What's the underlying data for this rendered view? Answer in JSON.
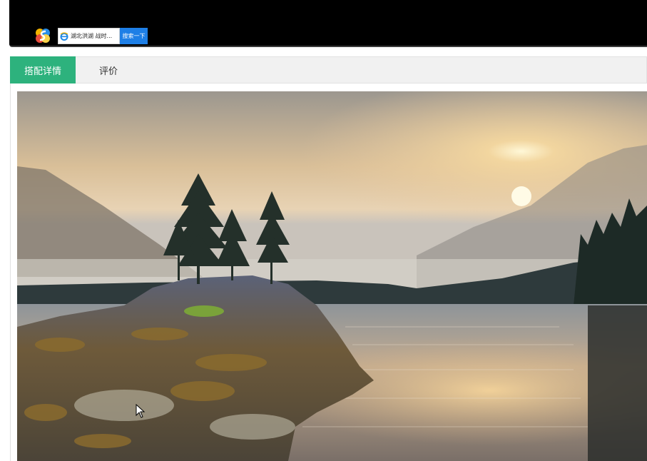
{
  "header": {
    "logo_icon": "color-s-logo-icon",
    "search": {
      "icon": "ie-browser-icon",
      "value": "湖北洪湖 战时...",
      "button_label": "搜索一下"
    }
  },
  "tabs": [
    {
      "label": "搭配详情",
      "active": true
    },
    {
      "label": "评价",
      "active": false
    }
  ],
  "colors": {
    "active_tab": "#2db27d",
    "search_button": "#1e7fe6",
    "banner": "#000000"
  },
  "content": {
    "image_icon": "lake-landscape-photo"
  }
}
